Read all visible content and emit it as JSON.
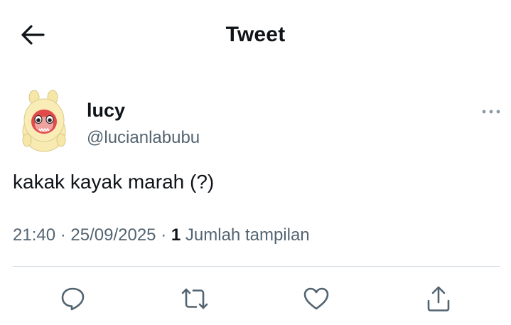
{
  "header": {
    "title": "Tweet",
    "back_icon": "arrow-left-icon"
  },
  "author": {
    "display_name": "lucy",
    "handle": "@lucianlabubu",
    "avatar_icon": "labubu-avatar-icon",
    "more_icon": "more-horizontal-icon"
  },
  "tweet": {
    "text": "kakak kayak marah (?)",
    "time": "21:40",
    "date": "25/09/2025",
    "views_count": "1",
    "views_label": "Jumlah tampilan",
    "separator": "·"
  },
  "actions": {
    "reply_icon": "reply-icon",
    "retweet_icon": "retweet-icon",
    "like_icon": "heart-icon",
    "share_icon": "share-icon"
  },
  "colors": {
    "text_primary": "#0f1419",
    "text_secondary": "#536471",
    "divider": "#cfd9de"
  }
}
